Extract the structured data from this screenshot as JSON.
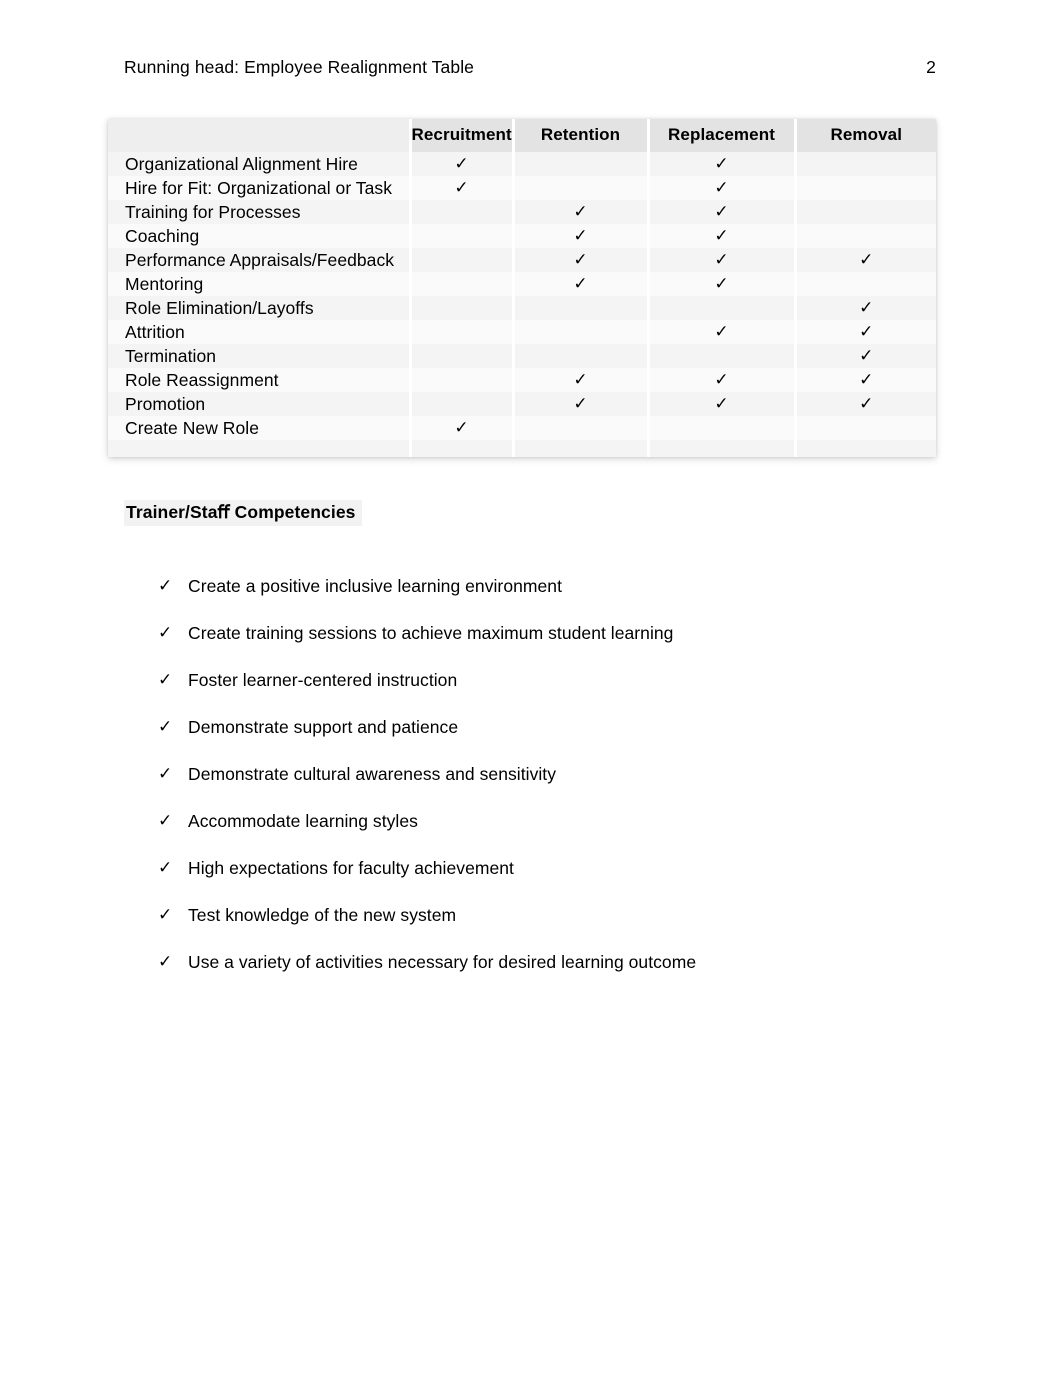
{
  "header": {
    "running_head": "Running head: Employee Realignment Table",
    "page_number": "2"
  },
  "table": {
    "name": "employee-realignment-table",
    "row_header_label": "",
    "columns": [
      "Recruitment",
      "Retention",
      "Replacement",
      "Removal"
    ],
    "check_glyph": "✓",
    "rows": [
      {
        "label": "Organizational Alignment Hire",
        "marks": [
          true,
          false,
          true,
          false
        ]
      },
      {
        "label": "Hire for Fit: Organizational or Task",
        "marks": [
          true,
          false,
          true,
          false
        ]
      },
      {
        "label": "Training for Processes",
        "marks": [
          false,
          true,
          true,
          false
        ]
      },
      {
        "label": "Coaching",
        "marks": [
          false,
          true,
          true,
          false
        ]
      },
      {
        "label": "Performance Appraisals/Feedback",
        "marks": [
          false,
          true,
          true,
          true
        ]
      },
      {
        "label": "Mentoring",
        "marks": [
          false,
          true,
          true,
          false
        ]
      },
      {
        "label": "Role Elimination/Layoffs",
        "marks": [
          false,
          false,
          false,
          true
        ]
      },
      {
        "label": "Attrition",
        "marks": [
          false,
          false,
          true,
          true
        ]
      },
      {
        "label": "Termination",
        "marks": [
          false,
          false,
          false,
          true
        ]
      },
      {
        "label": "Role Reassignment",
        "marks": [
          false,
          true,
          true,
          true
        ]
      },
      {
        "label": "Promotion",
        "marks": [
          false,
          true,
          true,
          true
        ]
      },
      {
        "label": "Create New Role",
        "marks": [
          true,
          false,
          false,
          false
        ]
      }
    ]
  },
  "competencies": {
    "heading": "Trainer/Staﬀ Competencies",
    "bullet_glyph": "✓",
    "items": [
      "Create a positive inclusive learning environment",
      "Create training sessions to achieve maximum student learning",
      "Foster learner-centered instruction",
      "Demonstrate support and patience",
      "Demonstrate cultural awareness and sensitivity",
      "Accommodate learning styles",
      "High expectations for faculty achievement",
      "Test knowledge of the new system",
      "Use a variety of activities necessary for desired learning outcome"
    ]
  }
}
